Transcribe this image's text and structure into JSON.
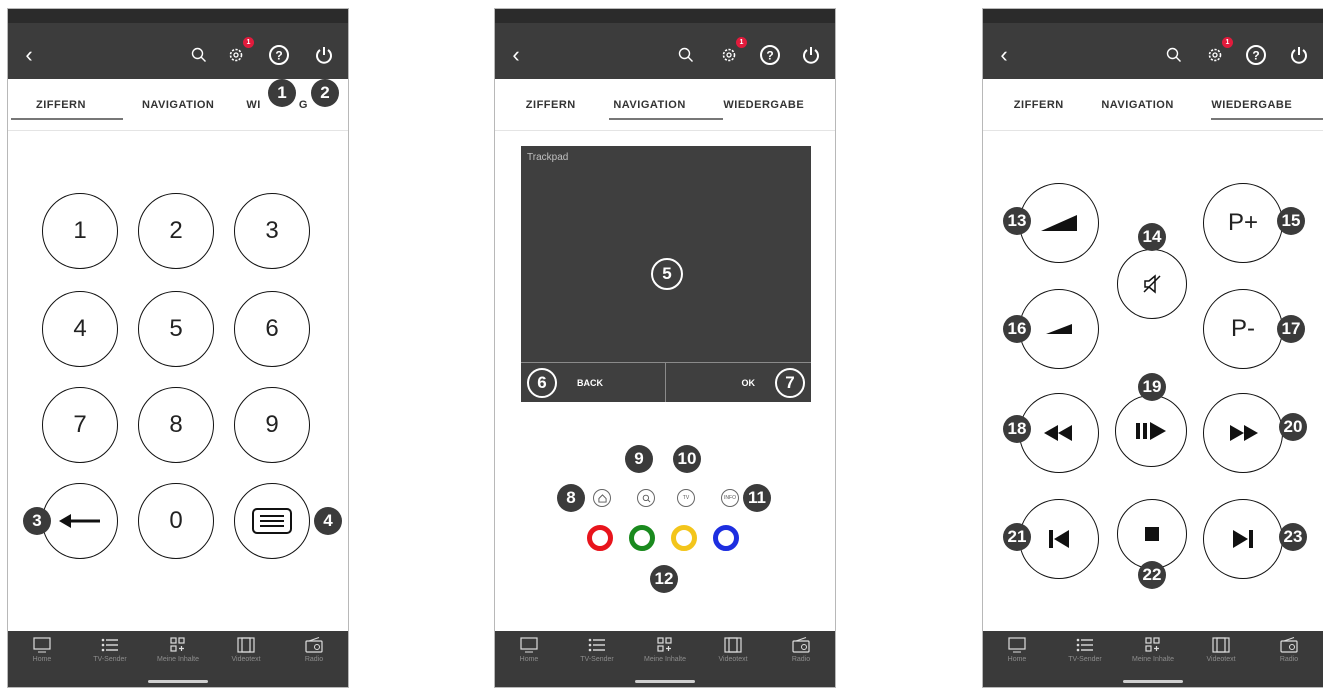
{
  "tabs": {
    "ziffern": "ZIFFERN",
    "navigation": "NAVIGATION",
    "wiedergabe": "WIEDERGABE",
    "wiedergabe_partial": "WI",
    "wiedergabe_partial_end": "G"
  },
  "badge": "1",
  "digits": [
    "1",
    "2",
    "3",
    "4",
    "5",
    "6",
    "7",
    "8",
    "9",
    "0"
  ],
  "markers": [
    "1",
    "2",
    "3",
    "4",
    "5",
    "6",
    "7",
    "8",
    "9",
    "10",
    "11",
    "12",
    "13",
    "14",
    "15",
    "16",
    "17",
    "18",
    "19",
    "20",
    "21",
    "22",
    "23"
  ],
  "trackpad": {
    "label": "Trackpad",
    "back": "BACK",
    "ok": "OK"
  },
  "small_buttons": {
    "tv": "TV",
    "info": "INFO"
  },
  "channel": {
    "plus": "P+",
    "minus": "P-"
  },
  "colors": {
    "red": "#e8141c",
    "green": "#1a8a1e",
    "yellow": "#f3c51b",
    "blue": "#1d2ee0",
    "topbar": "#3c3c3c",
    "navbar": "#3a3a3a",
    "badge": "#e21b3c"
  },
  "bottomnav": {
    "screen1": [
      "Home",
      "TV-Sender",
      "Meine Inhalte",
      "Videotext",
      "Radio"
    ],
    "screen2": [
      "Home",
      "TV-Sender",
      "Meine Inhalte",
      "Videotext",
      "Radio"
    ],
    "screen3": [
      "Home",
      "TV-Sender",
      "Meine Inhalte",
      "Videotext",
      "Radio"
    ]
  },
  "icons": [
    "back-icon",
    "search-icon",
    "gear-icon",
    "help-icon",
    "power-icon",
    "home-icon",
    "list-icon",
    "apps-icon",
    "film-icon",
    "radio-icon"
  ]
}
